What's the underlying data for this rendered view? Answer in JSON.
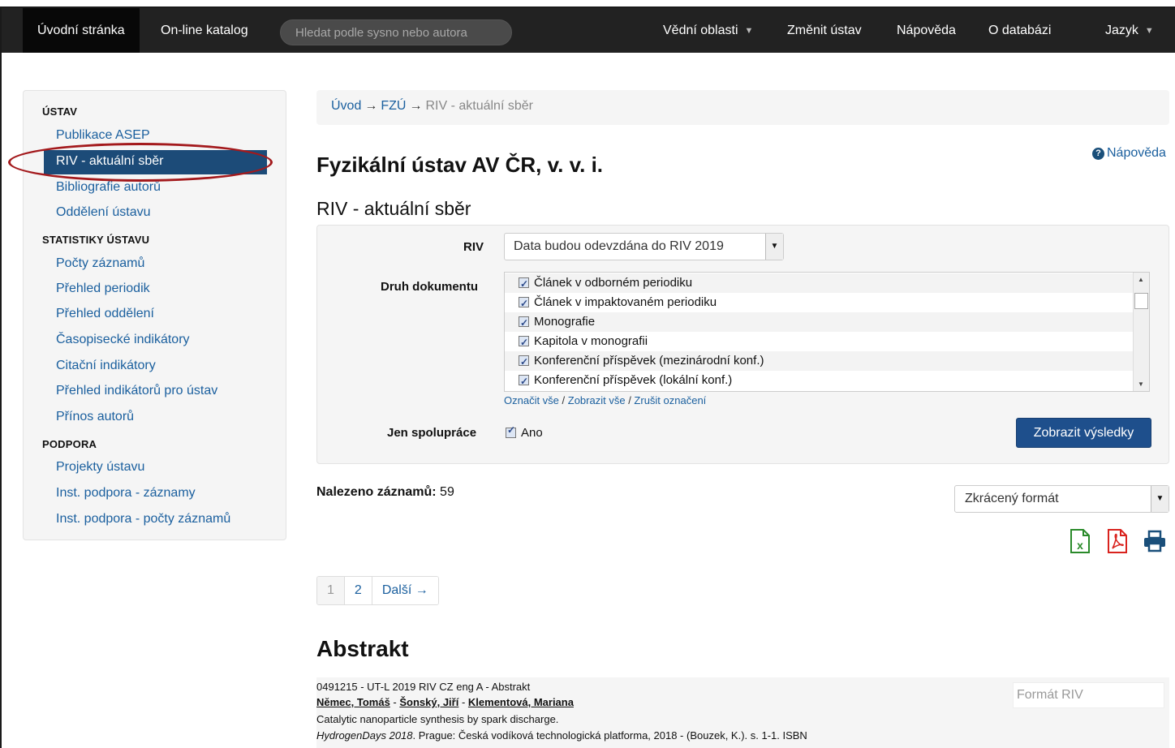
{
  "nav": {
    "home": "Úvodní stránka",
    "catalog": "On-line katalog",
    "search_placeholder": "Hledat podle sysno nebo autora",
    "fields": "Vědní oblasti",
    "change": "Změnit ústav",
    "help": "Nápověda",
    "about": "O databázi",
    "lang": "Jazyk"
  },
  "sidebar": {
    "sections": [
      {
        "header": "ÚSTAV",
        "items": [
          "Publikace ASEP",
          "RIV - aktuální sběr",
          "Bibliografie autorů",
          "Oddělení ústavu"
        ]
      },
      {
        "header": "STATISTIKY ÚSTAVU",
        "items": [
          "Počty záznamů",
          "Přehled periodik",
          "Přehled oddělení",
          "Časopisecké indikátory",
          "Citační indikátory",
          "Přehled indikátorů pro ústav",
          "Přínos autorů"
        ]
      },
      {
        "header": "PODPORA",
        "items": [
          "Projekty ústavu",
          "Inst. podpora - záznamy",
          "Inst. podpora - počty záznamů"
        ]
      }
    ],
    "active": "RIV - aktuální sběr"
  },
  "breadcrumb": {
    "home": "Úvod",
    "inst": "FZÚ",
    "current": "RIV - aktuální sběr",
    "sep": "→"
  },
  "help_link": "Nápověda",
  "page_title": "Fyzikální ústav AV ČR, v. v. i.",
  "section_title": "RIV - aktuální sběr",
  "filter": {
    "riv_label": "RIV",
    "riv_value": "Data budou odevzdána do RIV 2019",
    "doc_label": "Druh dokumentu",
    "doc_types": [
      "Článek v odborném periodiku",
      "Článek v impaktovaném periodiku",
      "Monografie",
      "Kapitola v monografii",
      "Konferenční příspěvek (mezinárodní konf.)",
      "Konferenční příspěvek (lokální konf.)"
    ],
    "link_select_all": "Označit vše",
    "link_show_all": "Zobrazit vše",
    "link_clear": "Zrušit označení",
    "coop_label": "Jen spolupráce",
    "coop_value": "Ano",
    "submit": "Zobrazit výsledky"
  },
  "results": {
    "found_label": "Nalezeno záznamů:",
    "found_count": "59",
    "format": "Zkrácený formát"
  },
  "pagination": {
    "pages": [
      "1",
      "2"
    ],
    "next": "Další →"
  },
  "abstract": {
    "title": "Abstrakt",
    "record": {
      "id_line": "0491215 - UT-L 2019 RIV CZ eng A - Abstrakt",
      "authors": [
        "Němec, Tomáš",
        "Šonský, Jiří",
        "Klementová, Mariana"
      ],
      "author_sep": " - ",
      "title": "Catalytic nanoparticle synthesis by spark discharge.",
      "source_italic": "HydrogenDays 2018",
      "source_rest": ". Prague: Česká vodíková technologická platforma, 2018 - (Bouzek, K.). s. 1-1. ISBN",
      "format_button": "Formát RIV"
    }
  },
  "colors": {
    "navbar": "#222222",
    "active": "#1c4b78",
    "link": "#1a5f9e",
    "highlight_ellipse": "#a3191c",
    "primary_button": "#1e4f8c"
  },
  "icons": [
    "excel-export-icon",
    "pdf-export-icon",
    "print-icon",
    "help-circle-icon"
  ]
}
